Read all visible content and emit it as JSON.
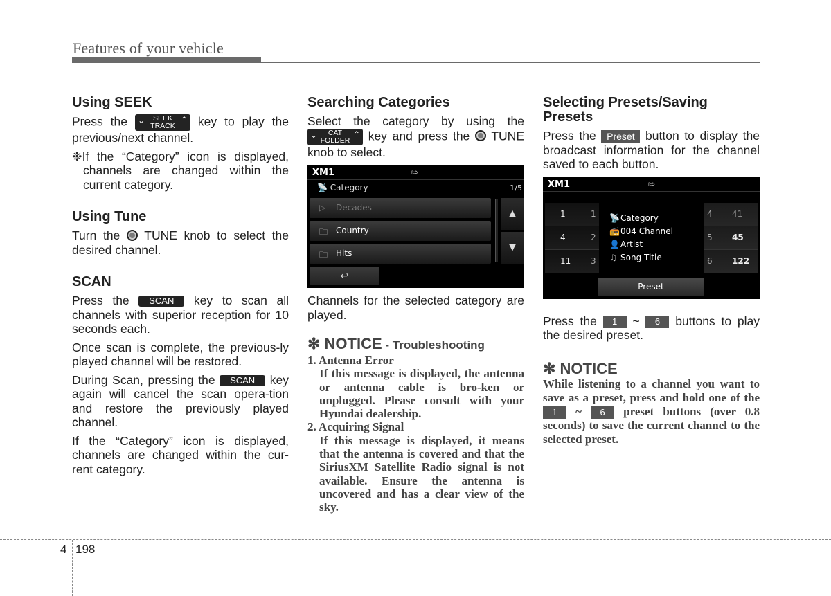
{
  "header": {
    "title": "Features of your vehicle"
  },
  "col1": {
    "seek": {
      "heading": "Using SEEK",
      "p1_before": "Press the",
      "key_top": "SEEK",
      "key_bottom": "TRACK",
      "p1_after": "key to play the previous/next channel.",
      "note": "❉If the “Category” icon is displayed, channels are changed within the current category."
    },
    "tune": {
      "heading": "Using Tune",
      "p_before": "Turn the",
      "p_after": "TUNE knob to select the desired channel."
    },
    "scan": {
      "heading": "SCAN",
      "p1_before": "Press the",
      "key_label": "SCAN",
      "p1_after": "key to scan all channels with superior reception for 10 seconds each.",
      "p2": "Once scan is complete, the previous-ly played channel will be restored.",
      "p3_before": "During Scan, pressing the",
      "p3_after": "key again will cancel the scan opera-tion and restore the previously played channel.",
      "p4": "If the “Category” icon is displayed, channels are changed within the cur-rent category."
    }
  },
  "col2": {
    "heading": "Searching Categories",
    "p1_before": "Select the category by using the",
    "key_top": "CAT",
    "key_bottom": "FOLDER",
    "p1_middle": "key and press the",
    "p1_after": "TUNE knob to select.",
    "screen": {
      "title": "XM1",
      "usb_icon": "usb-icon",
      "category_label": "Category",
      "page": "1/5",
      "items": [
        {
          "label": "Decades",
          "icon": "play-circle-icon",
          "dimmed": true
        },
        {
          "label": "Country",
          "icon": "folder-icon",
          "dimmed": false
        },
        {
          "label": "Hits",
          "icon": "folder-icon",
          "dimmed": false
        }
      ],
      "up_icon": "▲",
      "down_icon": "▼",
      "back_icon": "⮌"
    },
    "p2": "Channels for the selected category are played.",
    "notice": {
      "title": "✻ NOTICE",
      "subtitle": " - Troubleshooting",
      "item1_title": "1. Antenna Error",
      "item1_body": "If this message is displayed, the antenna or antenna cable is bro-ken or unplugged. Please consult with your Hyundai dealership.",
      "item2_title": "2. Acquiring Signal",
      "item2_body": "If this message is displayed, it means that the antenna is covered and that the SiriusXM Satellite Radio signal is not available. Ensure the antenna is uncovered and has a clear view of the sky."
    }
  },
  "col3": {
    "heading": "Selecting Presets/Saving Presets",
    "p1_before": "Press the",
    "preset_key": "Preset",
    "p1_after": "button to display the broadcast information for the channel saved to each button.",
    "screen": {
      "title": "XM1",
      "left_presets": [
        {
          "channel": "1",
          "number": "1"
        },
        {
          "channel": "4",
          "number": "2"
        },
        {
          "channel": "11",
          "number": "3"
        }
      ],
      "right_presets": [
        {
          "number": "4",
          "channel": "41"
        },
        {
          "number": "5",
          "channel": "45"
        },
        {
          "number": "6",
          "channel": "122"
        }
      ],
      "info": {
        "category": "Category",
        "channel": "004 Channel",
        "artist": "Artist",
        "song": "Song Title"
      },
      "preset_button": "Preset"
    },
    "p2_before": "Press the",
    "key_1": "1",
    "tilde": "~",
    "key_6": "6",
    "p2_after": "buttons to play the desired preset.",
    "notice": {
      "title": "✻ NOTICE",
      "body_before": "While listening to a channel you want to save as a preset, press and hold one of the",
      "body_after": "preset buttons (over 0.8 seconds) to save the current channel to the selected preset."
    }
  },
  "footer": {
    "chapter": "4",
    "page": "198"
  }
}
